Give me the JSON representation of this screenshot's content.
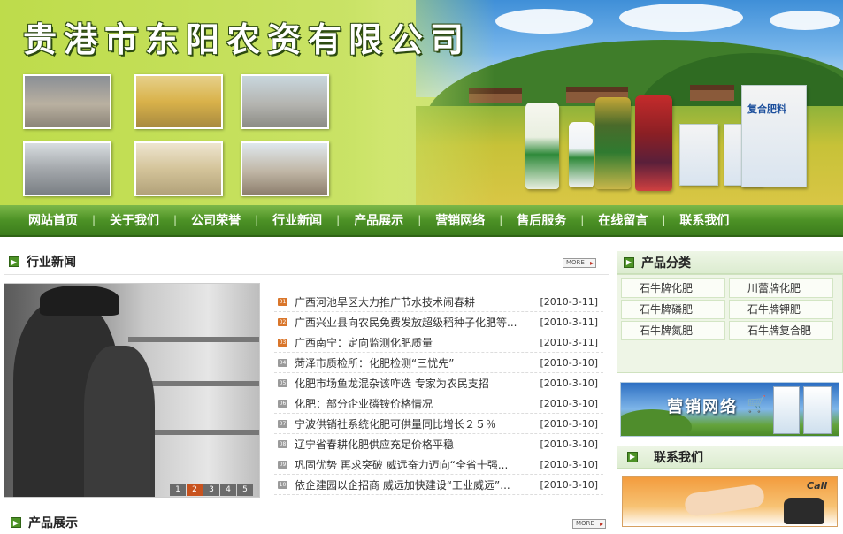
{
  "site": {
    "title": "贵港市东阳农资有限公司",
    "banner_bag_label": "复合肥料"
  },
  "nav": {
    "items": [
      "网站首页",
      "关于我们",
      "公司荣誉",
      "行业新闻",
      "产品展示",
      "营销网络",
      "售后服务",
      "在线留言",
      "联系我们"
    ]
  },
  "industry_news": {
    "title": "行业新闻",
    "more_label": "MORE",
    "pager": [
      "1",
      "2",
      "3",
      "4",
      "5"
    ],
    "pager_active": "2",
    "items": [
      {
        "title": "广西河池旱区大力推广节水技术闹春耕",
        "date": "[2010-3-11]",
        "icon": "01"
      },
      {
        "title": "广西兴业县向农民免费发放超级稻种子化肥等...",
        "date": "[2010-3-11]",
        "icon": "02"
      },
      {
        "title": "广西南宁：定向监测化肥质量",
        "date": "[2010-3-11]",
        "icon": "03"
      },
      {
        "title": "菏泽市质检所：化肥检测“三忧先”",
        "date": "[2010-3-10]",
        "icon": "04"
      },
      {
        "title": "化肥市场鱼龙混杂该咋选 专家为农民支招",
        "date": "[2010-3-10]",
        "icon": "05"
      },
      {
        "title": "化肥：部分企业磷铵价格情况",
        "date": "[2010-3-10]",
        "icon": "06"
      },
      {
        "title": "宁波供销社系统化肥可供量同比增长２５％",
        "date": "[2010-3-10]",
        "icon": "07"
      },
      {
        "title": "辽宁省春耕化肥供应充足价格平稳",
        "date": "[2010-3-10]",
        "icon": "08"
      },
      {
        "title": "巩固优势 再求突破 威远奋力迈向“全省十强...",
        "date": "[2010-3-10]",
        "icon": "09"
      },
      {
        "title": "依企建园以企招商 威远加快建设“工业威远”...",
        "date": "[2010-3-10]",
        "icon": "10"
      }
    ]
  },
  "product_show": {
    "title": "产品展示",
    "more_label": "MORE"
  },
  "product_categories": {
    "title": "产品分类",
    "items": [
      "石牛牌化肥",
      "川蕾牌化肥",
      "石牛牌磷肥",
      "石牛牌钾肥",
      "石牛牌氮肥",
      "石牛牌复合肥"
    ]
  },
  "marketing_banner": {
    "text": "营销网络"
  },
  "contact": {
    "title": "联系我们",
    "call_label": "Call"
  },
  "colors": {
    "nav_green": "#4d9226",
    "accent_orange": "#c8531f",
    "highlight_icon": "#d9762b",
    "normal_icon": "#9a9a9a"
  }
}
